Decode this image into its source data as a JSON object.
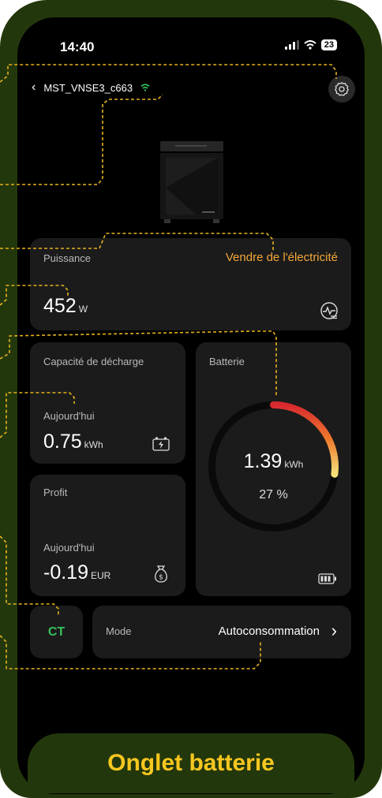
{
  "status": {
    "time": "14:40",
    "battery": "23"
  },
  "nav": {
    "device_name": "MST_VNSE3_c663"
  },
  "power": {
    "label": "Puissance",
    "mode": "Vendre de l'électricité",
    "value": "452",
    "unit": "W"
  },
  "discharge": {
    "label": "Capacité de décharge",
    "period": "Aujourd'hui",
    "value": "0.75",
    "unit": "kWh"
  },
  "profit": {
    "label": "Profit",
    "period": "Aujourd'hui",
    "value": "-0.19",
    "unit": "EUR"
  },
  "battery": {
    "label": "Batterie",
    "value": "1.39",
    "unit": "kWh",
    "percent_text": "27 %",
    "level": 0.27
  },
  "ct": {
    "label": "CT"
  },
  "mode": {
    "label": "Mode",
    "value": "Autoconsommation"
  },
  "banner": {
    "text": "Onglet batterie"
  },
  "colors": {
    "accent": "#f3a738",
    "ct_green": "#35c25b",
    "frame": "#23370c",
    "banner_text": "#f7c71f",
    "annotation": "#e5b21d"
  }
}
